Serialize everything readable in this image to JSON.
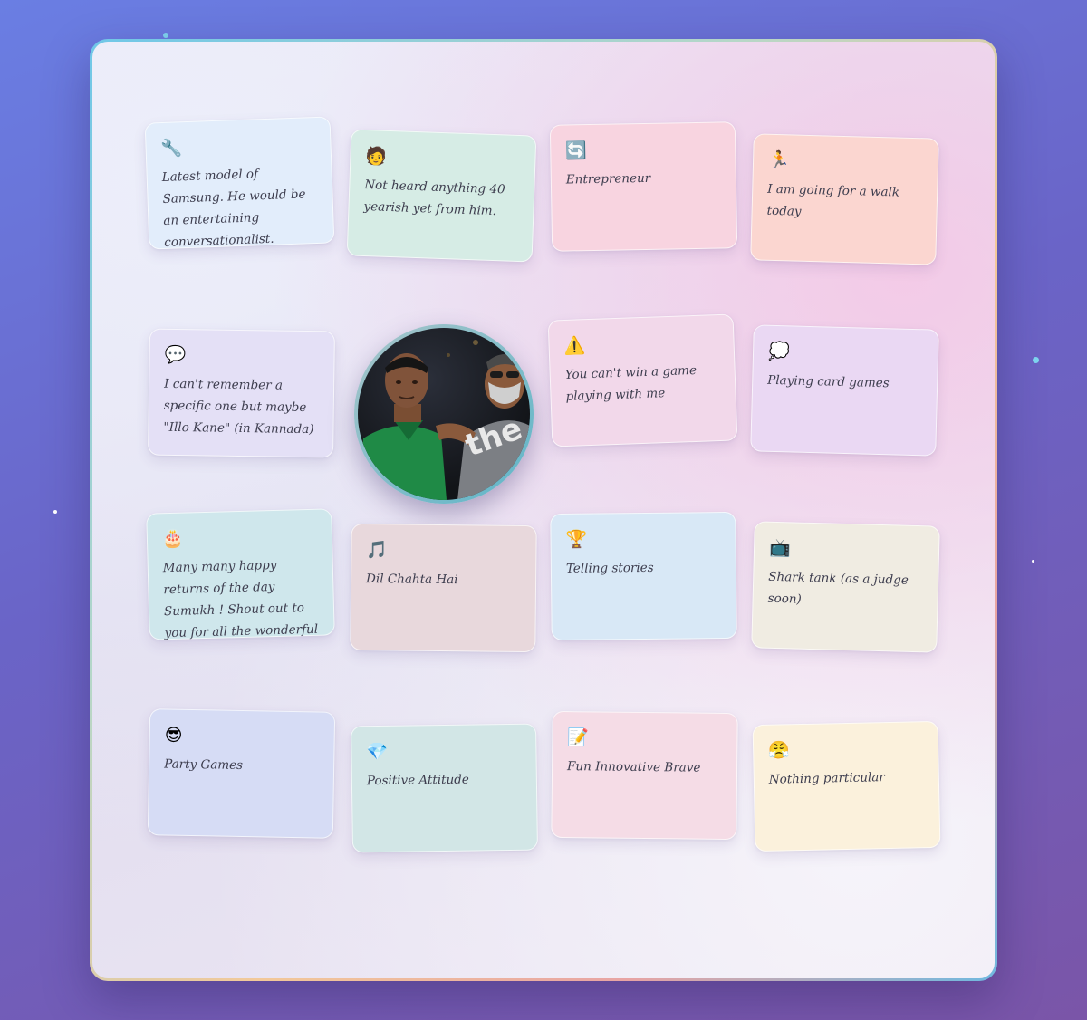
{
  "cards": [
    {
      "icon": "🔧",
      "text": "Latest model of Samsung. He would be an entertaining conversationalist.",
      "bg": "#e2edfb"
    },
    {
      "icon": "🧑",
      "text": "Not heard anything 40 yearish yet from him.",
      "bg": "#d6ece5"
    },
    {
      "icon": "🔄",
      "text": "Entrepreneur",
      "bg": "#f8d4e0"
    },
    {
      "icon": "🏃",
      "text": "I am going for a walk today",
      "bg": "#fbd6d0"
    },
    {
      "icon": "💬",
      "text": "I can't remember a specific one but maybe \"Illo Kane\" (in Kannada)",
      "bg": "#e4e0f6"
    },
    {
      "icon": "⚠️",
      "text": "You can't win a game playing with me",
      "bg": "#f2d8ea"
    },
    {
      "icon": "💭",
      "text": "Playing card games",
      "bg": "#ead8f3"
    },
    {
      "icon": "🎂",
      "text": "Many many happy returns of the day Sumukh ! Shout out to you for all the wonderful",
      "bg": "#cfe7ec"
    },
    {
      "icon": "🎵",
      "text": "Dil Chahta Hai",
      "bg": "#e8d8dc"
    },
    {
      "icon": "🏆",
      "text": "Telling stories",
      "bg": "#d8e8f6"
    },
    {
      "icon": "📺",
      "text": "Shark tank (as a judge soon)",
      "bg": "#f0ece2"
    },
    {
      "icon": "😎",
      "text": "Party Games",
      "bg": "#d6dcf5"
    },
    {
      "icon": "💎",
      "text": "Positive Attitude",
      "bg": "#d2e6e6"
    },
    {
      "icon": "📝",
      "text": "Fun Innovative Brave",
      "bg": "#f5dce6"
    },
    {
      "icon": "😤",
      "text": "Nothing particular",
      "bg": "#fbf1dc"
    }
  ],
  "photo": {
    "shirt_text": "the gap"
  }
}
